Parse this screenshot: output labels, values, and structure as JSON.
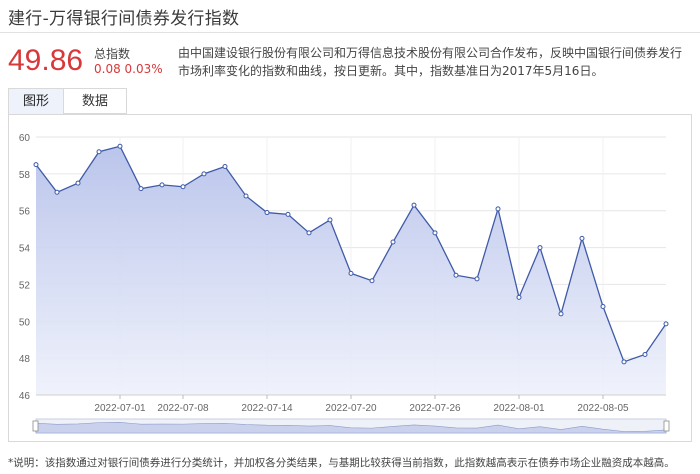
{
  "header": {
    "title": "建行-万得银行间债券发行指数"
  },
  "summary": {
    "value": "49.86",
    "label": "总指数",
    "change": "0.08 0.03%",
    "description": "由中国建设银行股份有限公司和万得信息技术股份有限公司合作发布，反映中国银行间债券发行市场利率变化的指数和曲线，按日更新。其中，指数基准日为2017年5月16日。"
  },
  "tabs": [
    {
      "label": "图形",
      "active": true
    },
    {
      "label": "数据",
      "active": false
    }
  ],
  "footnote": "*说明：该指数通过对银行间债券进行分类统计，并加权各分类结果，与基期比较获得当前指数，此指数越高表示在债券市场企业融资成本越高。",
  "colors": {
    "value_red": "#d9383b",
    "line": "#3f5aa8",
    "area_top": "#b7c2ea",
    "area_bottom": "#eef1fb"
  },
  "chart_data": {
    "type": "area",
    "title": "",
    "xlabel": "",
    "ylabel": "",
    "ylim": [
      46,
      60
    ],
    "yticks": [
      46,
      48,
      50,
      52,
      54,
      56,
      58,
      60
    ],
    "grid": true,
    "x_tick_labels": [
      {
        "label": "2022-07-01",
        "index": 4
      },
      {
        "label": "2022-07-08",
        "index": 7
      },
      {
        "label": "2022-07-14",
        "index": 11
      },
      {
        "label": "2022-07-20",
        "index": 15
      },
      {
        "label": "2022-07-26",
        "index": 19
      },
      {
        "label": "2022-08-01",
        "index": 23
      },
      {
        "label": "2022-08-05",
        "index": 27
      }
    ],
    "values": [
      58.5,
      57.0,
      57.5,
      59.2,
      59.5,
      57.2,
      57.4,
      57.3,
      58.0,
      58.4,
      56.8,
      55.9,
      55.8,
      54.8,
      55.5,
      52.6,
      52.2,
      54.3,
      56.3,
      54.8,
      52.5,
      52.3,
      56.1,
      51.3,
      54.0,
      50.4,
      54.5,
      50.8,
      47.8,
      48.2,
      49.86
    ]
  }
}
